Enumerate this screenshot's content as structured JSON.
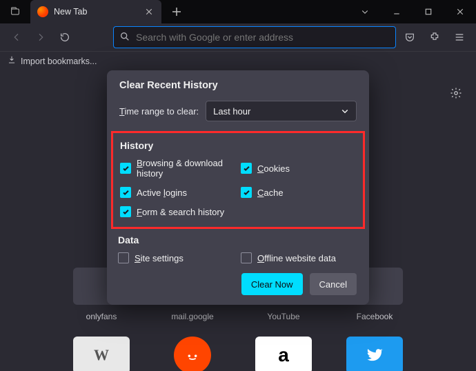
{
  "titlebar": {
    "tab_title": "New Tab"
  },
  "toolbar": {
    "search_placeholder": "Search with Google or enter address"
  },
  "bookmarks": {
    "import_label": "Import bookmarks..."
  },
  "dialog": {
    "title": "Clear Recent History",
    "time_label_pre": "T",
    "time_label_post": "ime range to clear:",
    "time_value": "Last hour",
    "history_heading": "History",
    "data_heading": "Data",
    "checks": {
      "browsing": {
        "pre": "B",
        "post": "rowsing & download history"
      },
      "cookies": {
        "pre": "C",
        "post": "ookies"
      },
      "logins_pre": "Active ",
      "logins_acc": "l",
      "logins_post": "ogins",
      "cache": {
        "pre": "C",
        "post": "ache"
      },
      "form": {
        "pre": "F",
        "post": "orm & search history"
      },
      "site": {
        "pre": "S",
        "post": "ite settings"
      },
      "offline": {
        "pre": "O",
        "post": "ffline website data"
      }
    },
    "clear_btn": "Clear Now",
    "cancel_btn": "Cancel"
  },
  "shortcuts": {
    "row1": [
      "onlyfans",
      "mail.google",
      "YouTube",
      "Facebook"
    ]
  }
}
